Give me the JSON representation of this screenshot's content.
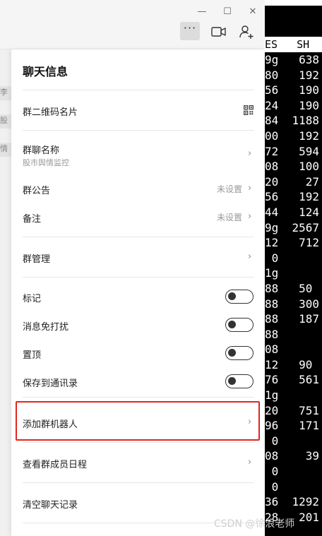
{
  "terminal": {
    "header": "ES   SH",
    "rows": [
      "9g   638",
      "80   192",
      "56   190",
      "24   190",
      "84  1188",
      "00   192",
      "72   594",
      "08   100",
      "20    27",
      "56   192",
      "44   124",
      "9g  2567",
      "12   712",
      " 0",
      "1g",
      "88   50",
      "88   300",
      "88   187",
      "88",
      "08",
      "12   90",
      "76   561",
      "1g",
      "20   751",
      "96   171",
      " 0",
      "08    39",
      " 0",
      " 0",
      "36  1292",
      "28   201"
    ]
  },
  "window": {
    "minimize": "—",
    "maximize": "☐",
    "close": "✕",
    "more": "···"
  },
  "left_list": {
    "items": [
      "李",
      "股",
      "情"
    ]
  },
  "panel": {
    "title": "聊天信息",
    "items": {
      "qr": {
        "label": "群二维码名片"
      },
      "group_name": {
        "label": "群聊名称",
        "sub": "股市舆情监控"
      },
      "notice": {
        "label": "群公告",
        "value": "未设置"
      },
      "remark": {
        "label": "备注",
        "value": "未设置"
      },
      "manage": {
        "label": "群管理"
      },
      "mark": {
        "label": "标记"
      },
      "mute": {
        "label": "消息免打扰"
      },
      "pin": {
        "label": "置顶"
      },
      "save_contacts": {
        "label": "保存到通讯录"
      },
      "add_robot": {
        "label": "添加群机器人"
      },
      "schedule": {
        "label": "查看群成员日程"
      },
      "clear_history": {
        "label": "清空聊天记录"
      }
    }
  },
  "watermark": "CSDN @徐浪老师",
  "colors": {
    "highlight": "#e0271f",
    "toggle_border": "#333333",
    "terminal_bg": "#000000"
  }
}
